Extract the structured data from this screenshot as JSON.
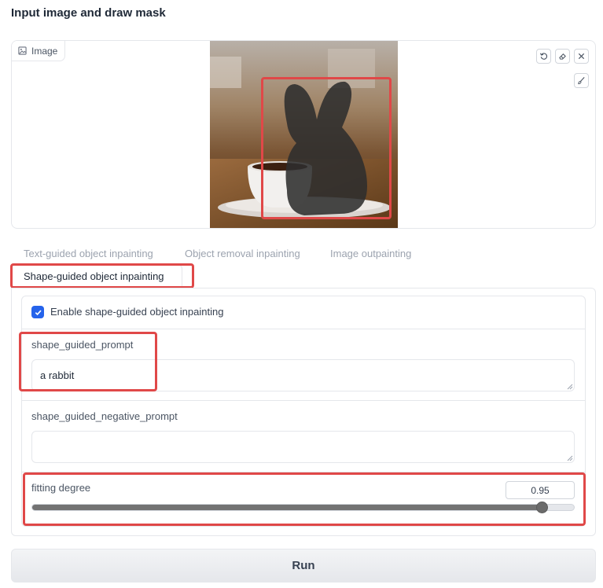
{
  "page": {
    "title": "Input image and draw mask"
  },
  "image_block": {
    "label": "Image",
    "icons": {
      "label": "image-icon",
      "undo": "undo-icon",
      "erase": "eraser-icon",
      "clear": "close-icon",
      "brush": "brush-icon"
    }
  },
  "tabs": [
    {
      "label": "Text-guided object inpainting",
      "active": false
    },
    {
      "label": "Object removal inpainting",
      "active": false
    },
    {
      "label": "Image outpainting",
      "active": false
    },
    {
      "label": "Shape-guided object inpainting",
      "active": true
    }
  ],
  "panel": {
    "checkbox": {
      "label": "Enable shape-guided object inpainting",
      "checked": true
    },
    "prompt": {
      "label": "shape_guided_prompt",
      "value": "a rabbit"
    },
    "negative_prompt": {
      "label": "shape_guided_negative_prompt",
      "value": ""
    },
    "fitting": {
      "label": "fitting degree",
      "value": "0.95",
      "fraction": 0.95
    }
  },
  "run_button": {
    "label": "Run"
  },
  "colors": {
    "accent": "#2563eb",
    "highlight": "#e04848",
    "slider": "#737373"
  }
}
